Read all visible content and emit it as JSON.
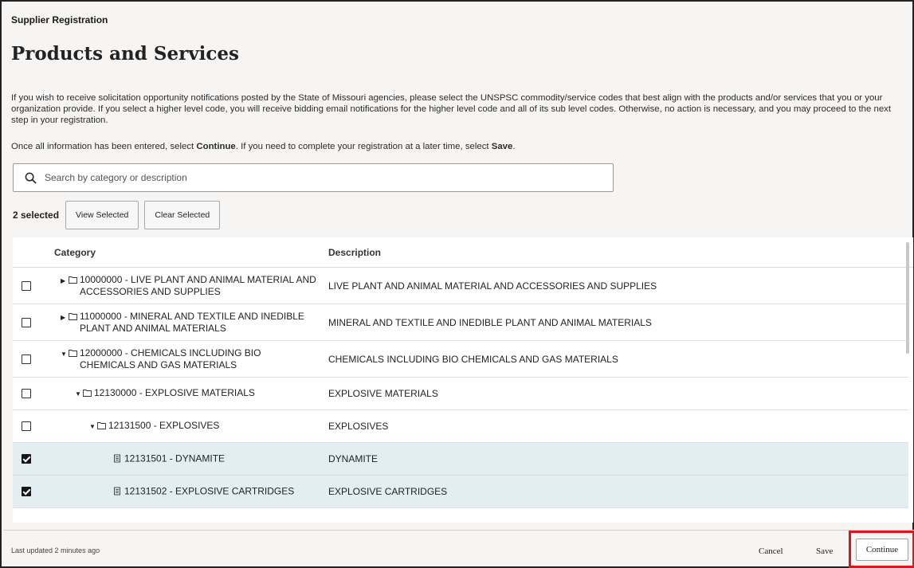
{
  "header": {
    "app_title": "Supplier Registration",
    "page_title": "Products and Services"
  },
  "intro_text": "If you wish to receive solicitation opportunity notifications posted by the State of Missouri agencies, please select the UNSPSC commodity/service codes that best align with the products and/or services that you or your organization provide. If you select a higher level code, you will receive bidding email notifications for the higher level code and all of its sub level codes. Otherwise, no action is necessary, and you may proceed to the next step in your registration.",
  "instruction": {
    "part1": "Once all information has been entered, select ",
    "continue_word": "Continue",
    "part2": ". If you need to complete your registration at a later time, select ",
    "save_word": "Save",
    "part3": "."
  },
  "search": {
    "placeholder": "Search by category or description",
    "icon": "search-icon"
  },
  "selection": {
    "count_label": "2 selected",
    "view_selected": "View Selected",
    "clear_selected": "Clear Selected"
  },
  "table": {
    "headers": {
      "category": "Category",
      "description": "Description"
    },
    "rows": [
      {
        "checked": false,
        "level": 0,
        "toggle": "expand",
        "icon": "folder-icon",
        "category": "10000000 - LIVE PLANT AND ANIMAL MATERIAL AND ACCESSORIES AND SUPPLIES",
        "description": "LIVE PLANT AND ANIMAL MATERIAL AND ACCESSORIES AND SUPPLIES"
      },
      {
        "checked": false,
        "level": 0,
        "toggle": "expand",
        "icon": "folder-icon",
        "category": "11000000 - MINERAL AND TEXTILE AND INEDIBLE PLANT AND ANIMAL MATERIALS",
        "description": "MINERAL AND TEXTILE AND INEDIBLE PLANT AND ANIMAL MATERIALS"
      },
      {
        "checked": false,
        "level": 0,
        "toggle": "collapse",
        "icon": "folder-icon",
        "category": "12000000 - CHEMICALS INCLUDING BIO CHEMICALS AND GAS MATERIALS",
        "description": "CHEMICALS INCLUDING BIO CHEMICALS AND GAS MATERIALS"
      },
      {
        "checked": false,
        "level": 1,
        "toggle": "collapse",
        "icon": "folder-icon",
        "category": "12130000 - EXPLOSIVE MATERIALS",
        "description": "EXPLOSIVE MATERIALS"
      },
      {
        "checked": false,
        "level": 2,
        "toggle": "collapse",
        "icon": "folder-icon",
        "category": "12131500 - EXPLOSIVES",
        "description": "EXPLOSIVES"
      },
      {
        "checked": true,
        "level": 3,
        "toggle": "none",
        "icon": "document-icon",
        "category": "12131501 - DYNAMITE",
        "description": "DYNAMITE"
      },
      {
        "checked": true,
        "level": 3,
        "toggle": "none",
        "icon": "document-icon",
        "category": "12131502 - EXPLOSIVE CARTRIDGES",
        "description": "EXPLOSIVE CARTRIDGES"
      }
    ]
  },
  "footer": {
    "last_updated": "Last updated 2 minutes ago",
    "cancel": "Cancel",
    "save": "Save",
    "continue": "Continue",
    "highlight_color": "#e0141a"
  }
}
